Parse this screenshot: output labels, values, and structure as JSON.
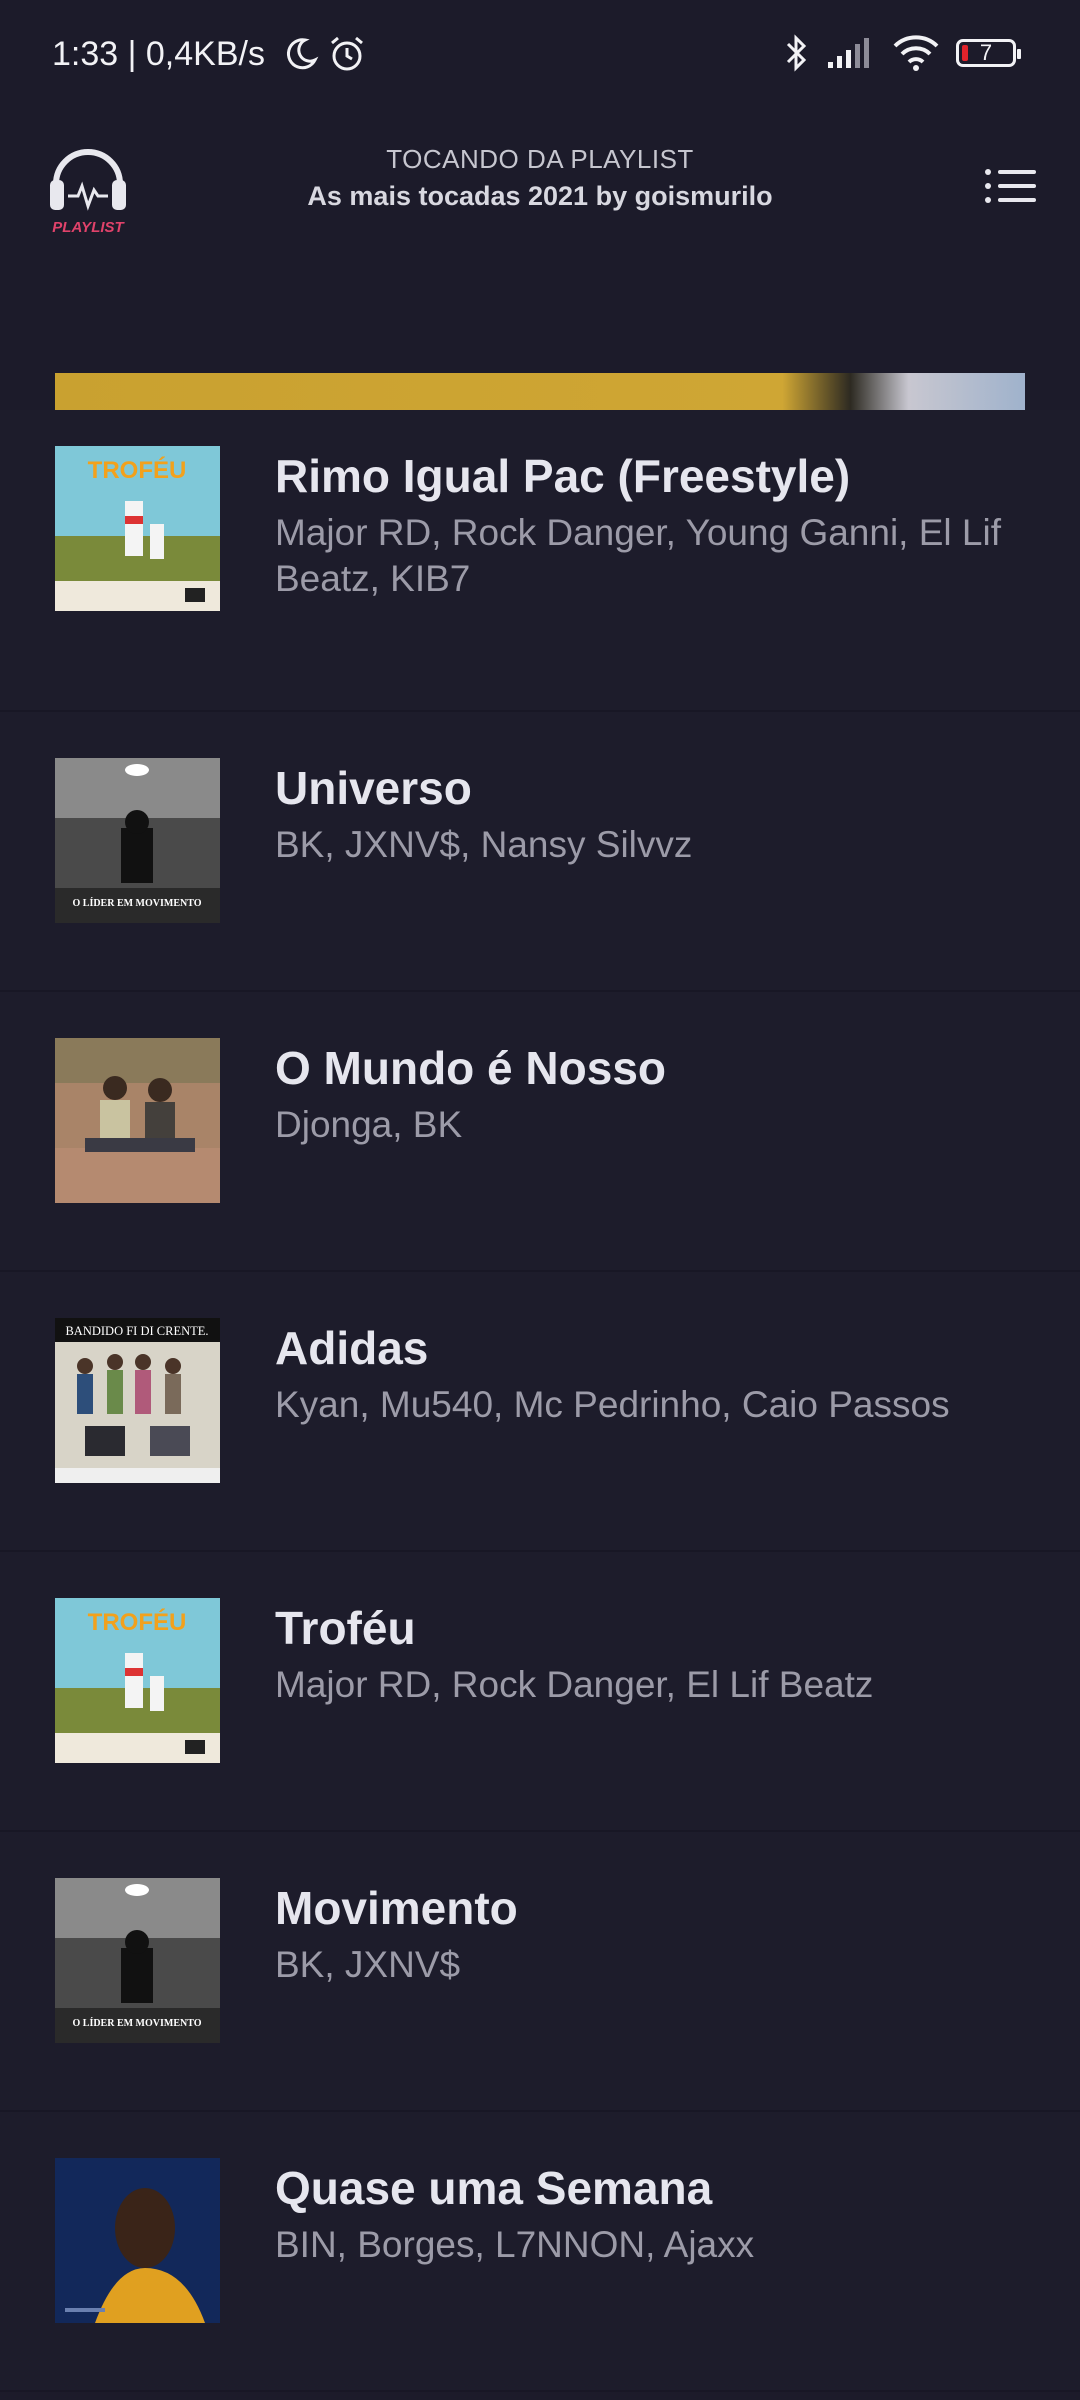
{
  "status_bar": {
    "time_speed": "1:33 | 0,4KB/s",
    "battery_level": "7",
    "icons": [
      "moon-icon",
      "alarm-icon",
      "bluetooth-icon",
      "signal-icon",
      "wifi-icon",
      "battery-icon"
    ]
  },
  "header": {
    "logo_text": "PLAYLIST",
    "subtitle": "TOCANDO DA PLAYLIST",
    "title": "As mais tocadas 2021 by goismurilo",
    "menu_icon": "list-menu-icon"
  },
  "tracks": [
    {
      "title": "Rimo Igual Pac (Freestyle)",
      "artists": "Major RD, Rock Danger, Young Ganni, El Lif Beatz, KIB7",
      "cover": "trofeu"
    },
    {
      "title": "Universo",
      "artists": "BK, JXNV$, Nansy Silvvz",
      "cover": "lider"
    },
    {
      "title": "O Mundo é Nosso",
      "artists": "Djonga, BK",
      "cover": "mundo"
    },
    {
      "title": "Adidas",
      "artists": "Kyan, Mu540, Mc Pedrinho, Caio Passos",
      "cover": "bandido"
    },
    {
      "title": "Troféu",
      "artists": "Major RD, Rock Danger, El Lif Beatz",
      "cover": "trofeu"
    },
    {
      "title": "Movimento",
      "artists": "BK, JXNV$",
      "cover": "lider"
    },
    {
      "title": "Quase uma Semana",
      "artists": "BIN, Borges, L7NNON, Ajaxx",
      "cover": "portrait"
    }
  ],
  "cover_art_text": {
    "trofeu": "TROFÉU",
    "lider": "O LÍDER EM MOVIMENTO",
    "bandido": "BANDIDO FI DI CRENTE."
  },
  "colors": {
    "background": "#1c1b2a",
    "title_text": "#e6e6ee",
    "artist_text": "#9c9ba8",
    "logo_accent": "#e0426a"
  }
}
